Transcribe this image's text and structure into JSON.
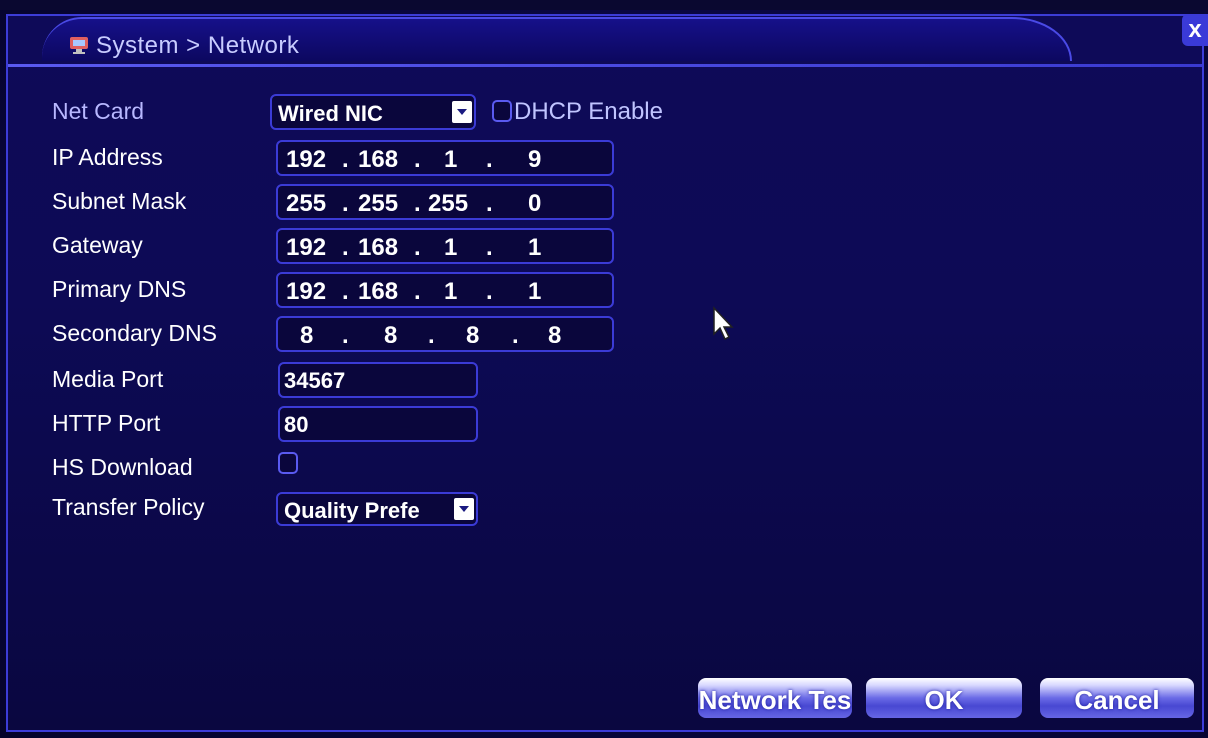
{
  "window": {
    "breadcrumb": "System > Network",
    "close_label": "x"
  },
  "form": {
    "net_card": {
      "label": "Net Card",
      "value": "Wired NIC"
    },
    "dhcp": {
      "label": "DHCP Enable",
      "checked": false
    },
    "ip_address": {
      "label": "IP Address",
      "octets": [
        "192",
        "168",
        "1",
        "9"
      ]
    },
    "subnet_mask": {
      "label": "Subnet Mask",
      "octets": [
        "255",
        "255",
        "255",
        "0"
      ]
    },
    "gateway": {
      "label": "Gateway",
      "octets": [
        "192",
        "168",
        "1",
        "1"
      ]
    },
    "primary_dns": {
      "label": "Primary DNS",
      "octets": [
        "192",
        "168",
        "1",
        "1"
      ]
    },
    "secondary_dns": {
      "label": "Secondary DNS",
      "octets": [
        "8",
        "8",
        "8",
        "8"
      ]
    },
    "media_port": {
      "label": "Media Port",
      "value": "34567"
    },
    "http_port": {
      "label": "HTTP Port",
      "value": "80"
    },
    "hs_download": {
      "label": "HS Download",
      "checked": false
    },
    "transfer_policy": {
      "label": "Transfer Policy",
      "value": "Quality Prefe"
    }
  },
  "buttons": {
    "network_test": "Network Tes",
    "ok": "OK",
    "cancel": "Cancel"
  },
  "colors": {
    "background": "#0d0a55",
    "border_accent": "#3b3bd6",
    "label_text": "#ffffff",
    "net_card_label": "#b8b8ff"
  },
  "icons": {
    "title_icon": "network-settings-icon",
    "close_icon": "close-icon",
    "dropdown_icon": "chevron-down-icon",
    "cursor_icon": "mouse-pointer-icon"
  }
}
